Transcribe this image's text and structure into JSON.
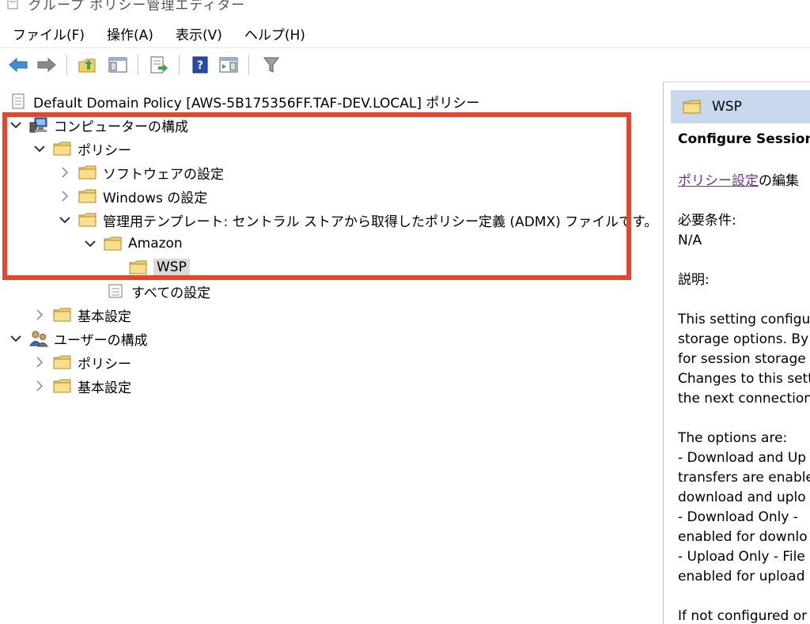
{
  "window": {
    "title": "グループ ポリシー管理エディター"
  },
  "menu": [
    {
      "label": "ファイル(F)"
    },
    {
      "label": "操作(A)"
    },
    {
      "label": "表示(V)"
    },
    {
      "label": "ヘルプ(H)"
    }
  ],
  "tree": {
    "root": "Default Domain Policy [AWS-5B175356FF.TAF-DEV.LOCAL] ポリシー",
    "computer_config": "コンピューターの構成",
    "c_policy": "ポリシー",
    "software_settings": "ソフトウェアの設定",
    "windows_settings": "Windows の設定",
    "admin_templates": "管理用テンプレート: セントラル ストアから取得したポリシー定義 (ADMX) ファイルです。",
    "amazon": "Amazon",
    "wsp": "WSP",
    "all_settings": "すべての設定",
    "c_basic_settings": "基本設定",
    "user_config": "ユーザーの構成",
    "u_policy": "ポリシー",
    "u_basic_settings": "基本設定"
  },
  "detail": {
    "header": "WSP",
    "title": "Configure Session S",
    "edit_link": "ポリシー設定",
    "edit_suffix": "の編集",
    "req_label": "必要条件:",
    "req_value": "N/A",
    "desc_label": "説明:",
    "lines": [
      "This setting configu",
      "storage options. By",
      "for session storage",
      "Changes to this sett",
      "the next connection"
    ],
    "options_lines": [
      "The options are:",
      "- Download and Up",
      "transfers are enable",
      "download and uplo",
      "- Download Only -",
      "enabled for downlo",
      "- Upload Only - File",
      "enabled for upload"
    ],
    "last_line": "If not configured or"
  },
  "colors": {
    "highlight_box": "#e8452c",
    "header_bg": "#c8d9ee",
    "link": "#7030a0",
    "folder": "#f2d06b"
  }
}
